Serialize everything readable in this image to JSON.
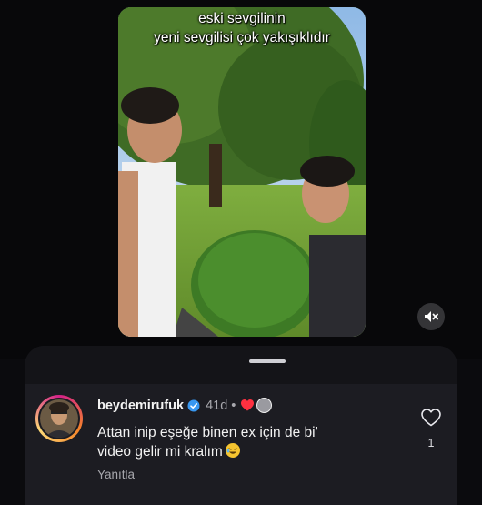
{
  "video": {
    "caption_line1": "eski sevgilinin",
    "caption_line2": "yeni sevgilisi çok yakışıklıdır",
    "mute_icon": "speaker-muted-icon"
  },
  "comment": {
    "username": "beydemirufuk",
    "verified_icon": "verified-badge-icon",
    "time": "41d",
    "separator": "•",
    "creator_liked_icon": "heart-icon",
    "text_line1": "Attan inip eşeğe binen ex için de bi’",
    "text_line2": "video gelir mi kralım",
    "emoji": "rolling-on-floor-laughing-emoji",
    "reply_label": "Yanıtla",
    "like_count": "1",
    "like_icon": "heart-outline-icon"
  },
  "colors": {
    "background": "#0b0b0e",
    "sheet": "#1c1c22",
    "verified": "#3897f0",
    "liked": "#ff3040",
    "muted_text": "#a7a7ad"
  }
}
